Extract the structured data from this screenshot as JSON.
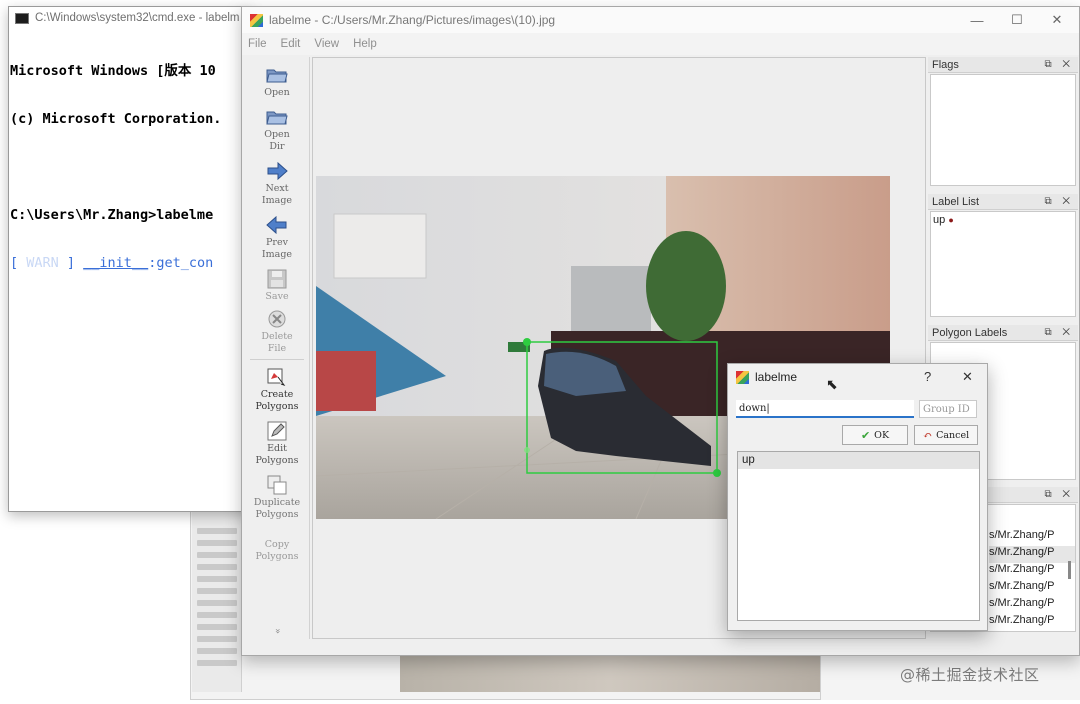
{
  "cmd": {
    "title": "C:\\Windows\\system32\\cmd.exe - labelm",
    "lines": [
      "Microsoft Windows [版本 10",
      "(c) Microsoft Corporation.",
      "",
      "C:\\Users\\Mr.Zhang>labelme"
    ],
    "log_prefix": "[ ",
    "log_level": "WARN",
    "log_mid": " ] ",
    "log_module": "__init__",
    "log_sep": ":",
    "log_func": "get_con"
  },
  "labelme": {
    "title": "labelme - C:/Users/Mr.Zhang/Pictures/images\\(10).jpg",
    "menu": [
      "File",
      "Edit",
      "View",
      "Help"
    ],
    "controls": {
      "minimize": "—",
      "maximize": "☐",
      "close": "✕"
    },
    "toolbar": {
      "open": "Open",
      "open_dir": "Open\nDir",
      "next_image": "Next\nImage",
      "prev_image": "Prev\nImage",
      "save": "Save",
      "delete_file": "Delete\nFile",
      "create_polygons": "Create\nPolygons",
      "edit_polygons": "Edit\nPolygons",
      "duplicate_polygons": "Duplicate\nPolygons",
      "copy_polygons": "Copy\nPolygons",
      "more": "»"
    },
    "docks": {
      "flags": {
        "title": "Flags"
      },
      "label_list": {
        "title": "Label List",
        "items": [
          "up"
        ]
      },
      "polygon_labels": {
        "title": "Polygon Labels"
      },
      "file_list": {
        "items": [
          "s/Mr.Zhang/P",
          "s/Mr.Zhang/P",
          "s/Mr.Zhang/P",
          "s/Mr.Zhang/P",
          "s/Mr.Zhang/P",
          "s/Mr.Zhang/P"
        ]
      },
      "button_glyphs": "⧉ ✕"
    }
  },
  "dialog": {
    "title": "labelme",
    "help": "?",
    "close": "✕",
    "label_value": "down",
    "group_id_placeholder": "Group ID",
    "ok_label": "OK",
    "cancel_label": "Cancel",
    "list_items": [
      "up"
    ]
  },
  "watermark": "@稀土掘金技术社区",
  "colors": {
    "selection_box": "#2ecc40",
    "label_dot": "#8b1a1a",
    "input_underline": "#2a73c9"
  }
}
